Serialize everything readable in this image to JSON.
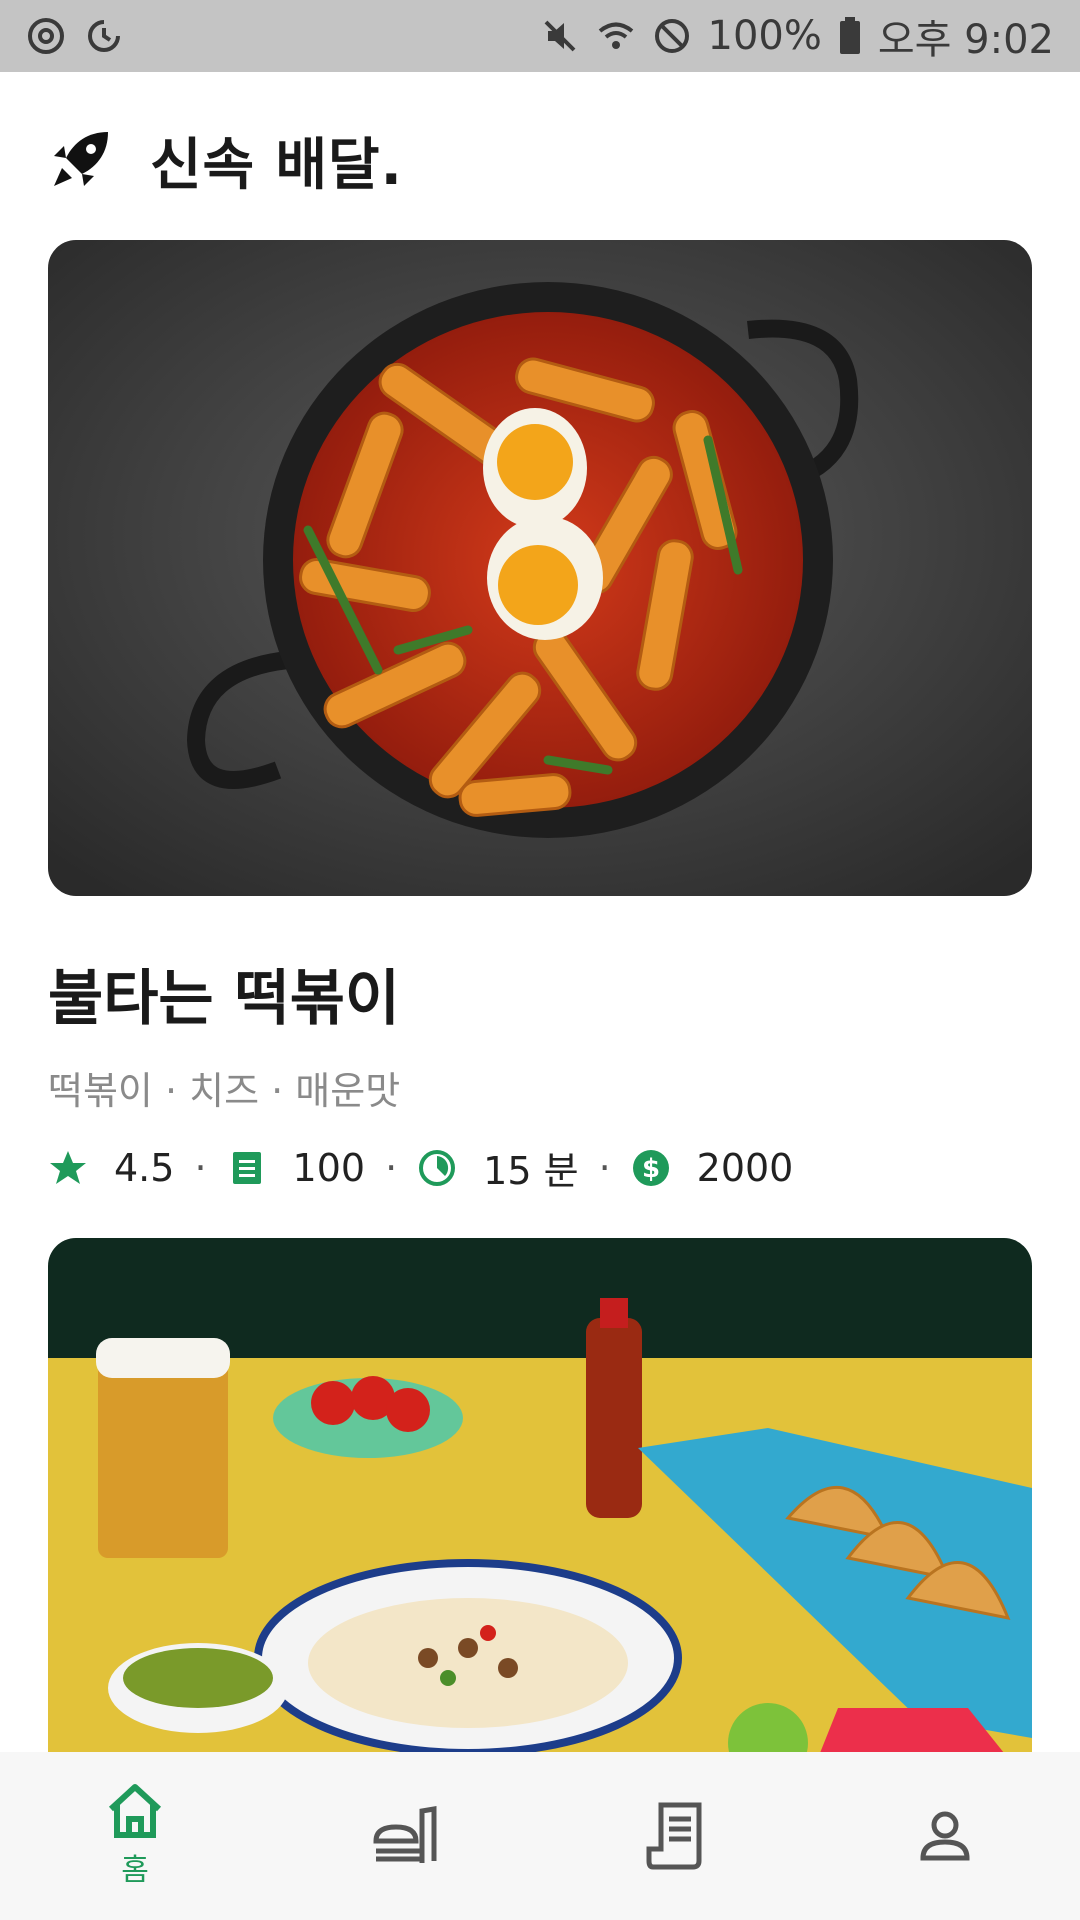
{
  "status_bar": {
    "battery": "100%",
    "time": "오후 9:02"
  },
  "header": {
    "title": "신속 배달.",
    "icon": "rocket-icon"
  },
  "restaurant": {
    "name": "불타는 떡볶이",
    "tags": "떡볶이 · 치즈 · 매운맛",
    "rating": "4.5",
    "reviews": "100",
    "time": "15 분",
    "delivery_fee": "2000",
    "image": "tteokbokki-photo"
  },
  "next_card": {
    "image": "tacos-photo"
  },
  "bottom_nav": {
    "home_label": "홈",
    "items": [
      "home-icon",
      "store-icon",
      "receipt-icon",
      "profile-icon"
    ]
  },
  "colors": {
    "accent": "#1f9a5a",
    "status_bar": "#c4c4c4"
  }
}
